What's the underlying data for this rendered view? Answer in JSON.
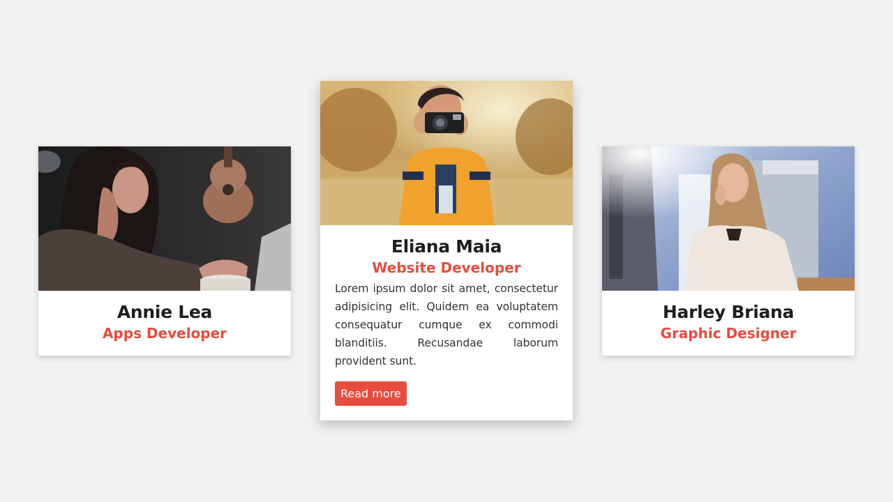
{
  "cards": [
    {
      "name": "Annie Lea",
      "role": "Apps Developer"
    },
    {
      "name": "Eliana Maia",
      "role": "Website Developer",
      "description": "Lorem ipsum dolor sit amet, consectetur adipisicing elit. Quidem ea voluptatem consequatur cumque ex commodi blanditiis. Recusandae laborum provident sunt.",
      "button_label": "Read more"
    },
    {
      "name": "Harley Briana",
      "role": "Graphic Designer"
    }
  ],
  "colors": {
    "accent": "#e74c3c",
    "background": "#f1f1f1",
    "card": "#ffffff",
    "name_text": "#1e1e1e"
  }
}
